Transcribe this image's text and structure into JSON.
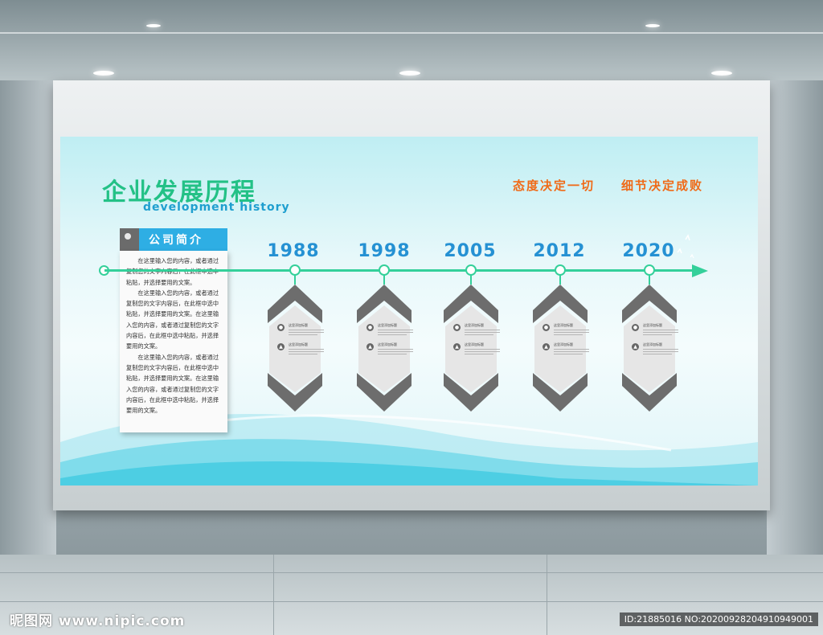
{
  "board": {
    "title_cn": "企业发展历程",
    "title_en": "development history",
    "motto_1": "态度决定一切",
    "motto_2": "细节决定成败"
  },
  "intro": {
    "title": "公司简介",
    "paragraphs": [
      "在这里输入您的内容，或者通过复制您的文字内容后，在此框中选中粘贴，并选择要用的文案。",
      "在这里输入您的内容，或者通过复制您的文字内容后，在此框中选中粘贴，并选择要用的文案。在这里输入您的内容，或者通过复制您的文字内容后，在此框中选中粘贴，并选择要用的文案。",
      "在这里输入您的内容，或者通过复制您的文字内容后，在此框中选中粘贴，并选择要用的文案。在这里输入您的内容，或者通过复制您的文字内容后，在此框中选中粘贴，并选择要用的文案。"
    ]
  },
  "timeline": [
    {
      "year": "1988",
      "item1": "这里添加标题",
      "item2": "这里添加标题"
    },
    {
      "year": "1998",
      "item1": "这里添加标题",
      "item2": "这里添加标题"
    },
    {
      "year": "2005",
      "item1": "这里添加标题",
      "item2": "这里添加标题"
    },
    {
      "year": "2012",
      "item1": "这里添加标题",
      "item2": "这里添加标题"
    },
    {
      "year": "2020",
      "item1": "这里添加标题",
      "item2": "这里添加标题"
    }
  ],
  "watermark": {
    "left": "昵图网 www.nipic.com",
    "right": "ID:21885016 NO:20200928204910949001"
  },
  "colors": {
    "title_green": "#23c186",
    "year_blue": "#2591d3",
    "motto_orange": "#f06a17",
    "timeline_green": "#34d09a",
    "tab_blue": "#2eaee4"
  }
}
